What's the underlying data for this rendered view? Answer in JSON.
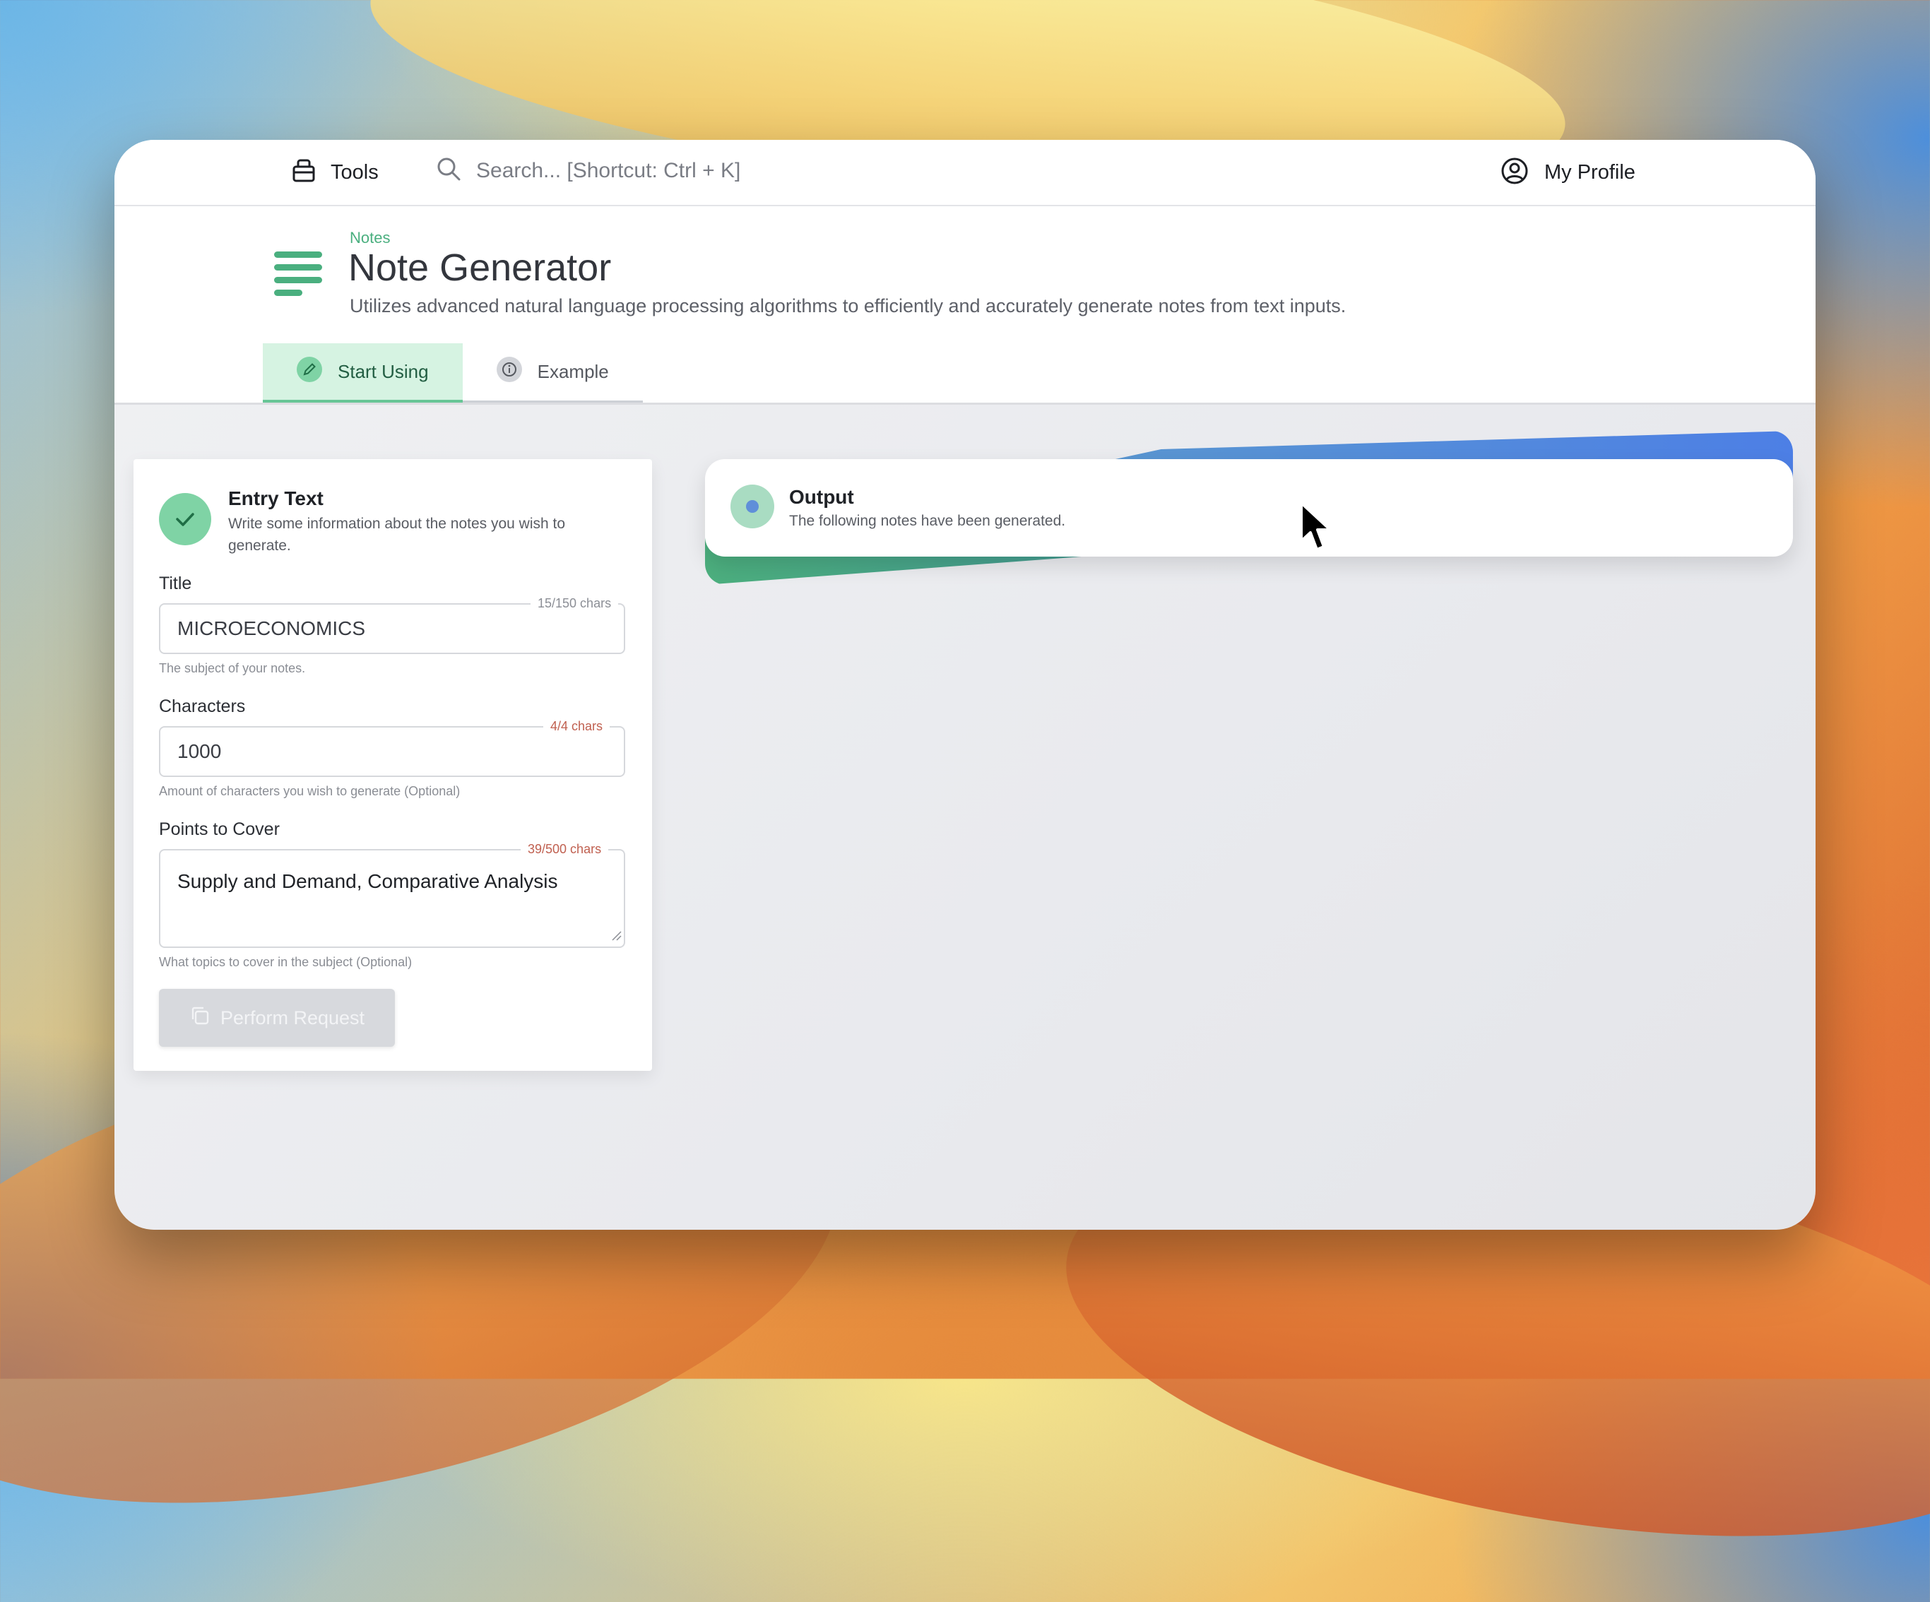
{
  "topbar": {
    "tools_label": "Tools",
    "search_placeholder": "Search... [Shortcut: Ctrl + K]",
    "profile_label": "My Profile"
  },
  "header": {
    "breadcrumb": "Notes",
    "title": "Note Generator",
    "description": "Utilizes advanced natural language processing algorithms to efficiently and accurately generate notes from text inputs."
  },
  "tabs": [
    {
      "label": "Start Using",
      "icon": "pencil-icon",
      "active": true
    },
    {
      "label": "Example",
      "icon": "info-icon",
      "active": false
    }
  ],
  "entry": {
    "title": "Entry Text",
    "description": "Write some information about the notes you wish to generate.",
    "fields": {
      "title": {
        "label": "Title",
        "value": "MICROECONOMICS",
        "counter": "15/150 chars",
        "hint": "The subject of your notes."
      },
      "characters": {
        "label": "Characters",
        "value": "1000",
        "counter": "4/4 chars",
        "hint": "Amount of characters you wish to generate (Optional)"
      },
      "points": {
        "label": "Points to Cover",
        "value": "Supply and Demand, Comparative Analysis",
        "counter": "39/500 chars",
        "hint": "What topics to cover in the subject (Optional)"
      }
    },
    "submit_label": "Perform Request"
  },
  "output": {
    "title": "Output",
    "description": "The following notes have been generated."
  },
  "colors": {
    "accent_green": "#4aaf7f",
    "tab_active_bg": "#d6f3e2",
    "counter_warn": "#c06050",
    "accent_blue": "#4d7fe5"
  }
}
